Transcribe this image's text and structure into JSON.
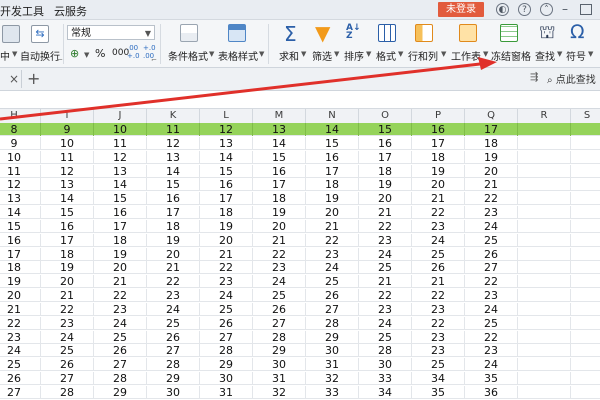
{
  "menubar": {
    "items": [
      "开发工具",
      "云服务"
    ],
    "login_label": "未登录"
  },
  "ribbon": {
    "merge_label": "中",
    "wrap_label": "自动换行",
    "number_format": "常规",
    "percent_label": "%",
    "thousands_label": "000",
    "decimal_inc_label": ".00 +.0",
    "decimal_dec_label": "+.0 .00",
    "conditional_format": "条件格式",
    "table_style": "表格样式",
    "sum_label": "求和",
    "filter_label": "筛选",
    "sort_label": "排序",
    "format_label": "格式",
    "row_col_label": "行和列",
    "worksheet_label": "工作表",
    "freeze_label": "冻结窗格",
    "find_label": "查找",
    "symbol_label": "符号"
  },
  "tabstrip": {
    "close_glyph": "×",
    "add_glyph": "+",
    "find_placeholder": "点此查找"
  },
  "colors": {
    "green_row": "#95d35a",
    "annotation_red": "#e0302a",
    "login_red": "#e25b3d"
  },
  "grid": {
    "columns": [
      "H",
      "I",
      "J",
      "K",
      "L",
      "M",
      "N",
      "O",
      "P",
      "Q",
      "R",
      "S"
    ],
    "rows": [
      [
        "8",
        "9",
        "10",
        "11",
        "12",
        "13",
        "14",
        "15",
        "16",
        "17"
      ],
      [
        "9",
        "10",
        "11",
        "12",
        "13",
        "14",
        "15",
        "16",
        "17",
        "18"
      ],
      [
        "10",
        "11",
        "12",
        "13",
        "14",
        "15",
        "16",
        "17",
        "18",
        "19"
      ],
      [
        "11",
        "12",
        "13",
        "14",
        "15",
        "16",
        "17",
        "18",
        "19",
        "20"
      ],
      [
        "12",
        "13",
        "14",
        "15",
        "16",
        "17",
        "18",
        "19",
        "20",
        "21"
      ],
      [
        "13",
        "14",
        "15",
        "16",
        "17",
        "18",
        "19",
        "20",
        "21",
        "22"
      ],
      [
        "14",
        "15",
        "16",
        "17",
        "18",
        "19",
        "20",
        "21",
        "22",
        "23"
      ],
      [
        "15",
        "16",
        "17",
        "18",
        "19",
        "20",
        "21",
        "22",
        "23",
        "24"
      ],
      [
        "16",
        "17",
        "18",
        "19",
        "20",
        "21",
        "22",
        "23",
        "24",
        "25"
      ],
      [
        "17",
        "18",
        "19",
        "20",
        "21",
        "22",
        "23",
        "24",
        "25",
        "26"
      ],
      [
        "18",
        "19",
        "20",
        "21",
        "22",
        "23",
        "24",
        "25",
        "26",
        "27"
      ],
      [
        "19",
        "20",
        "21",
        "22",
        "23",
        "24",
        "25",
        "21",
        "21",
        "22"
      ],
      [
        "20",
        "21",
        "22",
        "23",
        "24",
        "25",
        "26",
        "22",
        "22",
        "23"
      ],
      [
        "21",
        "22",
        "23",
        "24",
        "25",
        "26",
        "27",
        "23",
        "23",
        "24"
      ],
      [
        "22",
        "23",
        "24",
        "25",
        "26",
        "27",
        "28",
        "24",
        "22",
        "25"
      ],
      [
        "23",
        "24",
        "25",
        "26",
        "27",
        "28",
        "29",
        "25",
        "23",
        "22"
      ],
      [
        "24",
        "25",
        "26",
        "27",
        "28",
        "29",
        "30",
        "28",
        "23",
        "23"
      ],
      [
        "25",
        "26",
        "27",
        "28",
        "29",
        "30",
        "31",
        "30",
        "25",
        "24"
      ],
      [
        "26",
        "27",
        "28",
        "29",
        "30",
        "31",
        "32",
        "33",
        "34",
        "35"
      ],
      [
        "27",
        "28",
        "29",
        "30",
        "31",
        "32",
        "33",
        "34",
        "35",
        "36"
      ]
    ]
  }
}
